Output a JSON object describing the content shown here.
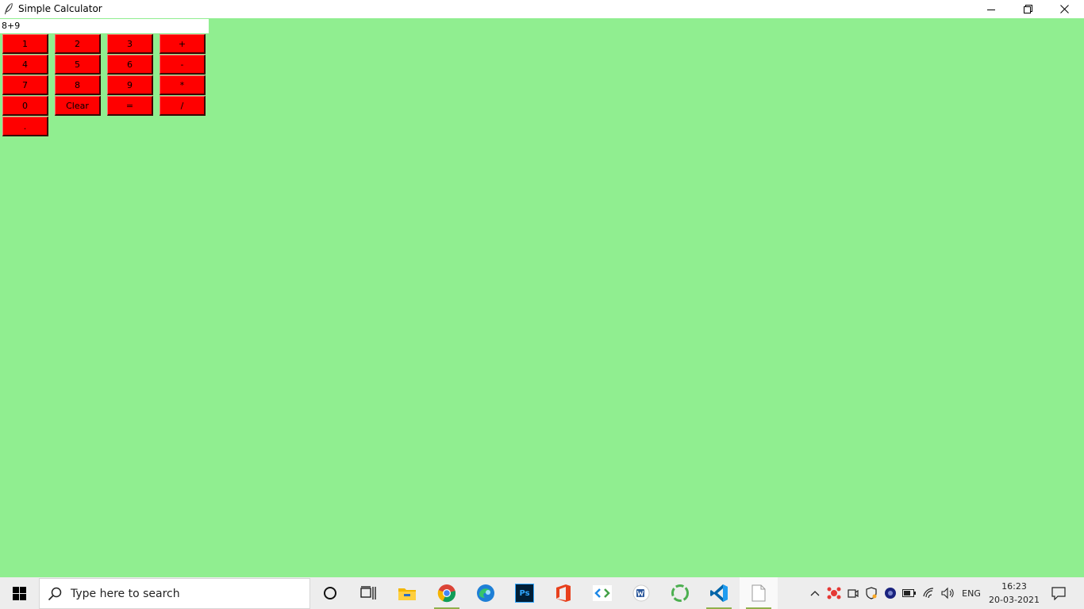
{
  "window": {
    "title": "Simple Calculator",
    "minimize_icon": "minimize-icon",
    "restore_icon": "restore-icon",
    "close_icon": "close-icon"
  },
  "calculator": {
    "display_value": "8+9",
    "background_color": "#90EE90",
    "button_color": "#ff0000",
    "buttons": [
      {
        "label": "1"
      },
      {
        "label": "2"
      },
      {
        "label": "3"
      },
      {
        "label": "+"
      },
      {
        "label": "4"
      },
      {
        "label": "5"
      },
      {
        "label": "6"
      },
      {
        "label": "-"
      },
      {
        "label": "7"
      },
      {
        "label": "8"
      },
      {
        "label": "9"
      },
      {
        "label": "*"
      },
      {
        "label": "0"
      },
      {
        "label": "Clear"
      },
      {
        "label": "="
      },
      {
        "label": "/"
      },
      {
        "label": "."
      }
    ]
  },
  "taskbar": {
    "search_placeholder": "Type here to search",
    "language": "ENG",
    "time": "16:23",
    "date": "20-03-2021",
    "apps": [
      "cortana-circle-icon",
      "task-view-icon",
      "file-explorer-icon",
      "chrome-icon",
      "edge-icon",
      "photoshop-icon",
      "office-icon",
      "code-editor-icon",
      "word-icon",
      "sync-icon",
      "vscode-icon",
      "blank-document-icon"
    ],
    "ps_label": "Ps"
  }
}
